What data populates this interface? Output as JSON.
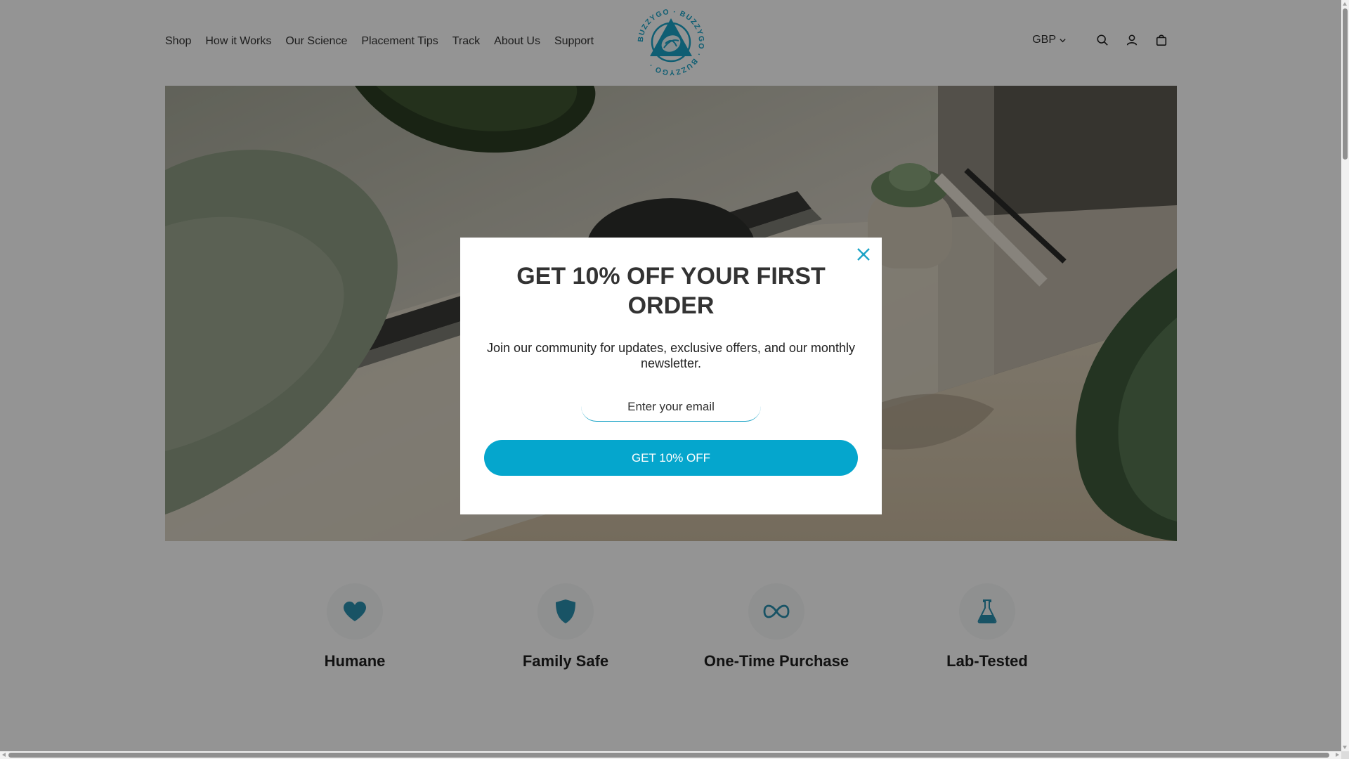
{
  "header": {
    "nav": [
      "Shop",
      "How it Works",
      "Our Science",
      "Placement Tips",
      "Track",
      "About Us",
      "Support"
    ],
    "logo_text": "BUZZYGO",
    "currency": "GBP",
    "icons": [
      "search-icon",
      "account-icon",
      "cart-icon"
    ]
  },
  "features": [
    {
      "label": "Humane",
      "icon": "heart-icon"
    },
    {
      "label": "Family Safe",
      "icon": "shield-icon"
    },
    {
      "label": "One-Time Purchase",
      "icon": "infinity-icon"
    },
    {
      "label": "Lab-Tested",
      "icon": "flask-icon"
    }
  ],
  "popup": {
    "title": "GET 10% OFF YOUR FIRST ORDER",
    "subtitle": "Join our community for updates, exclusive offers, and our monthly newsletter.",
    "email_placeholder": "Enter your email",
    "email_value": "",
    "cta_label": "GET 10% OFF"
  },
  "colors": {
    "accent": "#05a6cd",
    "brand_teal": "#1aa3c6",
    "icon_teal": "#2a8fae",
    "overlay": "rgba(0,0,0,0.42)"
  }
}
